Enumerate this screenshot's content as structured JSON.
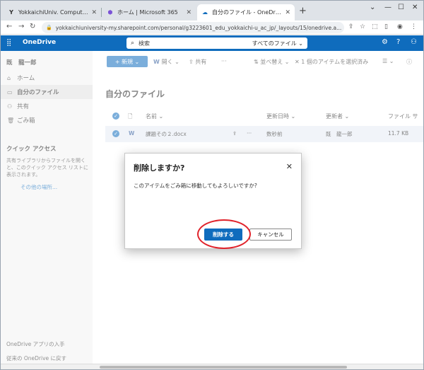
{
  "browser": {
    "tabs": [
      {
        "label": "YokkaichiUniv. ComputerCenter |",
        "icon": "Y"
      },
      {
        "label": "ホーム | Microsoft 365",
        "icon": "⬢"
      },
      {
        "label": "自分のファイル - OneDrive",
        "icon": "☁"
      }
    ],
    "url": "yokkaichiuniversity-my.sharepoint.com/personal/g3223601_edu_yokkaichi-u_ac_jp/_layouts/15/onedrive.a..."
  },
  "header": {
    "app_title": "OneDrive",
    "search_placeholder": "検索",
    "search_scope": "すべてのファイル ⌄"
  },
  "sidebar": {
    "user": "既　龍一郎",
    "items": [
      {
        "label": "ホーム",
        "icon": "⌂"
      },
      {
        "label": "自分のファイル",
        "icon": "▭"
      },
      {
        "label": "共有",
        "icon": "⚇"
      },
      {
        "label": "ごみ箱",
        "icon": "🗑"
      }
    ],
    "quick_access_title": "クイック アクセス",
    "quick_access_text": "共有ライブラリからファイルを開くと、このクイック アクセス リストに表示されます。",
    "quick_access_link": "その他の場所...",
    "footer_get_app": "OneDrive アプリの入手",
    "footer_classic": "従来の OneDrive に戻す"
  },
  "commandbar": {
    "new": "+ 新規 ⌄",
    "open": "開く ⌄",
    "share": "共有",
    "more": "···",
    "sort": "並べ替え ⌄",
    "selected": "1 個のアイテムを選択済み",
    "view": "☰ ⌄",
    "info": "ⓘ"
  },
  "main": {
    "title": "自分のファイル",
    "columns": {
      "name": "名前 ⌄",
      "modified": "更新日時 ⌄",
      "modified_by": "更新者 ⌄",
      "size": "ファイル サ"
    },
    "row": {
      "name": "課題その２.docx",
      "modified": "数秒前",
      "modified_by": "既　龍一郎",
      "size": "11.7 KB"
    }
  },
  "dialog": {
    "title": "削除しますか?",
    "message": "このアイテムをごみ箱に移動してもよろしいですか?",
    "delete": "削除する",
    "cancel": "キャンセル"
  },
  "colors": {
    "accent": "#0f6cbd",
    "highlight_ring": "#e0232b"
  }
}
